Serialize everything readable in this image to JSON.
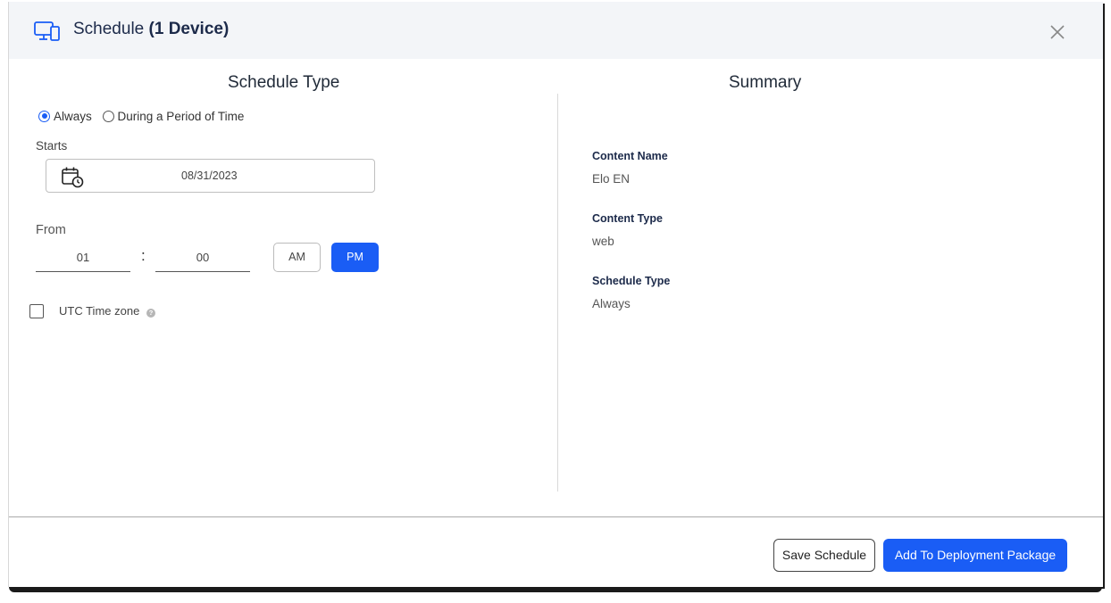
{
  "header": {
    "title_prefix": "Schedule",
    "title_count": "(1 Device)",
    "icon": "devices-icon",
    "close_icon": "close-icon"
  },
  "schedule_type": {
    "heading": "Schedule Type",
    "options": [
      {
        "label": "Always",
        "selected": true
      },
      {
        "label": "During a Period of Time",
        "selected": false
      }
    ],
    "starts_label": "Starts",
    "start_date": "08/31/2023",
    "calendar_icon": "calendar-clock-icon",
    "from_label": "From",
    "hour": "01",
    "colon": ":",
    "minute": "00",
    "am_label": "AM",
    "pm_label": "PM",
    "selected_period": "PM",
    "utc_label": "UTC Time zone",
    "utc_checked": false,
    "help_icon": "help-icon"
  },
  "summary": {
    "heading": "Summary",
    "items": [
      {
        "key": "Content Name",
        "value": "Elo EN"
      },
      {
        "key": "Content Type",
        "value": "web"
      },
      {
        "key": "Schedule Type",
        "value": "Always"
      }
    ]
  },
  "footer": {
    "save_label": "Save Schedule",
    "add_label": "Add To Deployment Package"
  },
  "colors": {
    "accent": "#1a5df5",
    "header_bg": "#f3f5f8",
    "title_text": "#1c2a4a"
  }
}
